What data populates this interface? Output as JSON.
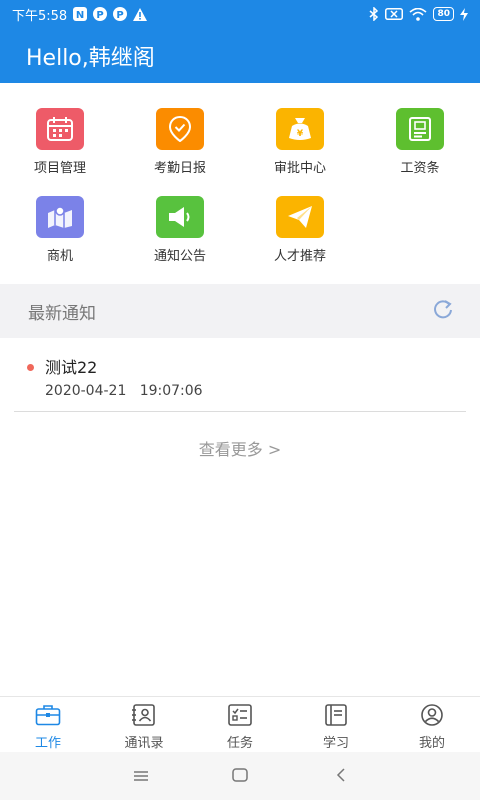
{
  "status_bar": {
    "time": "下午5:58",
    "battery": "80",
    "icons": [
      "n-app-icon",
      "p-app-icon",
      "p-app-icon",
      "warning-icon",
      "bluetooth-icon",
      "sim-icon",
      "wifi-icon",
      "charging-icon"
    ]
  },
  "header": {
    "greeting": "Hello,韩继阁"
  },
  "colors": {
    "primary": "#1e88e5",
    "tile_project": "#ee5b68",
    "tile_attendance": "#fb8c00",
    "tile_approval": "#fbb400",
    "tile_salary": "#5ebf2f",
    "tile_business": "#7b82e8",
    "tile_notice": "#58c23e",
    "tile_talent": "#fbb400",
    "unread_dot": "#f0675a"
  },
  "grid": {
    "items": [
      {
        "label": "项目管理",
        "icon": "calendar-icon"
      },
      {
        "label": "考勤日报",
        "icon": "location-check-icon"
      },
      {
        "label": "审批中心",
        "icon": "money-bag-icon"
      },
      {
        "label": "工资条",
        "icon": "payslip-icon"
      },
      {
        "label": "商机",
        "icon": "map-icon"
      },
      {
        "label": "通知公告",
        "icon": "megaphone-icon"
      },
      {
        "label": "人才推荐",
        "icon": "paper-plane-icon"
      }
    ]
  },
  "notices": {
    "section_title": "最新通知",
    "items": [
      {
        "title": "测试22",
        "time": "2020-04-21   19:07:06"
      }
    ],
    "more_label": "查看更多 >"
  },
  "tabs": [
    {
      "label": "工作",
      "icon": "briefcase-icon",
      "active": true
    },
    {
      "label": "通讯录",
      "icon": "contacts-icon",
      "active": false
    },
    {
      "label": "任务",
      "icon": "task-list-icon",
      "active": false
    },
    {
      "label": "学习",
      "icon": "book-icon",
      "active": false
    },
    {
      "label": "我的",
      "icon": "profile-icon",
      "active": false
    }
  ]
}
